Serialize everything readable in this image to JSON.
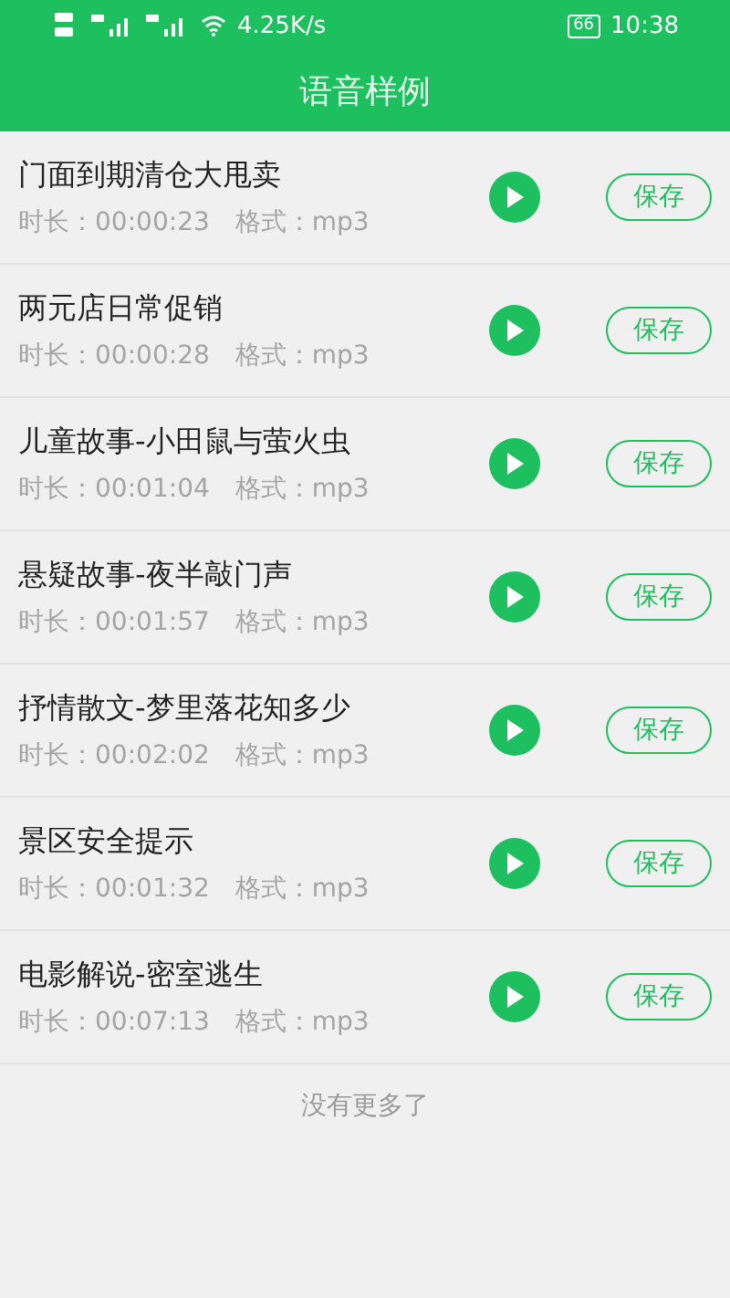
{
  "status_bar": {
    "network_speed": "4.25K/s",
    "battery": "66",
    "time": "10:38"
  },
  "header": {
    "title": "语音样例"
  },
  "samples": [
    {
      "title": "门面到期清仓大甩卖",
      "duration": "时长：00:00:23",
      "format": "格式：mp3",
      "save": "保存"
    },
    {
      "title": "两元店日常促销",
      "duration": "时长：00:00:28",
      "format": "格式：mp3",
      "save": "保存"
    },
    {
      "title": "儿童故事-小田鼠与萤火虫",
      "duration": "时长：00:01:04",
      "format": "格式：mp3",
      "save": "保存"
    },
    {
      "title": "悬疑故事-夜半敲门声",
      "duration": "时长：00:01:57",
      "format": "格式：mp3",
      "save": "保存"
    },
    {
      "title": "抒情散文-梦里落花知多少",
      "duration": "时长：00:02:02",
      "format": "格式：mp3",
      "save": "保存"
    },
    {
      "title": "景区安全提示",
      "duration": "时长：00:01:32",
      "format": "格式：mp3",
      "save": "保存"
    },
    {
      "title": "电影解说-密室逃生",
      "duration": "时长：00:07:13",
      "format": "格式：mp3",
      "save": "保存"
    }
  ],
  "footer": "没有更多了"
}
